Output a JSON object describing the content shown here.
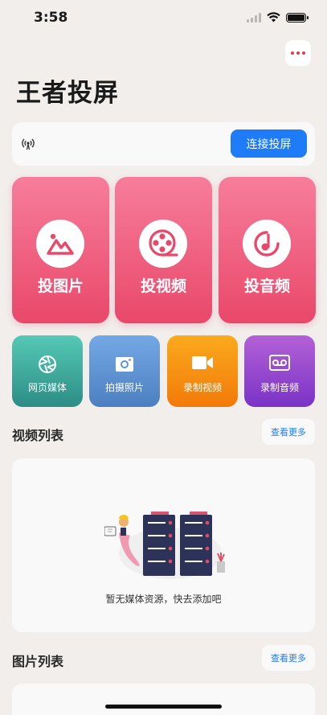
{
  "status": {
    "time": "3:58"
  },
  "header": {
    "title": "王者投屏"
  },
  "connect": {
    "button_label": "连接投屏"
  },
  "big_cards": [
    {
      "label": "投图片",
      "icon": "image-icon"
    },
    {
      "label": "投视频",
      "icon": "film-reel-icon"
    },
    {
      "label": "投音频",
      "icon": "music-icon"
    }
  ],
  "small_cards": [
    {
      "label": "网页媒体",
      "icon": "aperture-icon",
      "color": "#3FB8A6"
    },
    {
      "label": "拍摄照片",
      "icon": "camera-icon",
      "color": "#5E93D4"
    },
    {
      "label": "录制视频",
      "icon": "video-camera-icon",
      "color": "#F5900F"
    },
    {
      "label": "录制音频",
      "icon": "cassette-icon",
      "color": "#8C45D2"
    }
  ],
  "video_section": {
    "title": "视频列表",
    "more_label": "查看更多",
    "empty_text": "暂无媒体资源，快去添加吧"
  },
  "image_section": {
    "title": "图片列表",
    "more_label": "查看更多"
  },
  "colors": {
    "accent": "#1E7CF8",
    "card_gradient_top": "#F77D9B",
    "card_gradient_bottom": "#E9486A",
    "more_dots": "#E8394F"
  }
}
